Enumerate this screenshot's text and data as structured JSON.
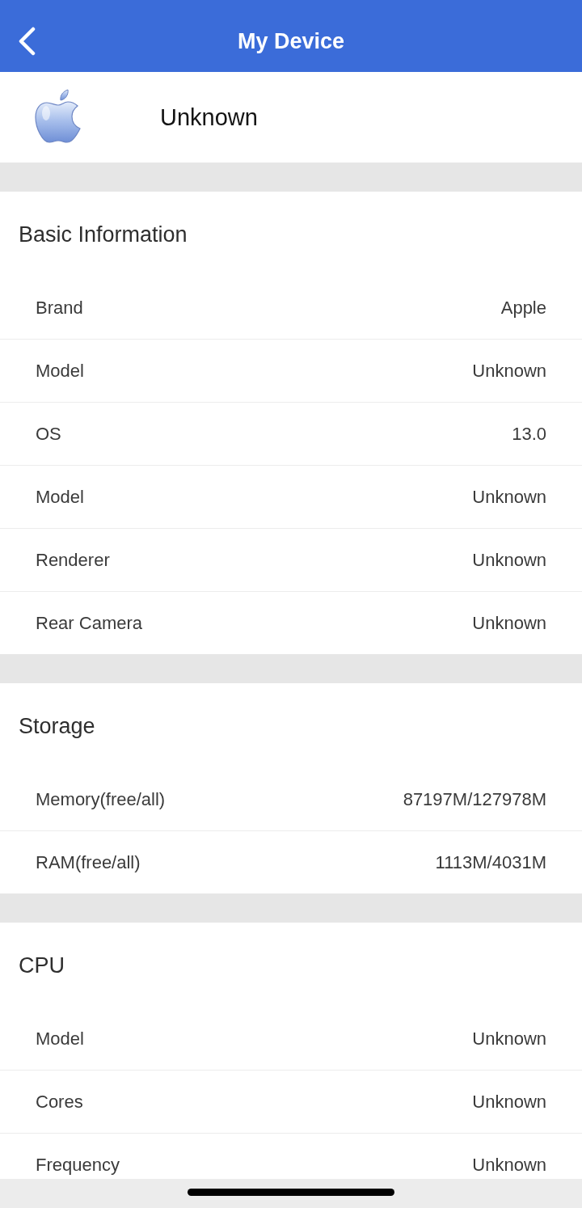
{
  "header": {
    "title": "My Device"
  },
  "device": {
    "name": "Unknown"
  },
  "sections": [
    {
      "title": "Basic Information",
      "rows": [
        {
          "label": "Brand",
          "value": "Apple"
        },
        {
          "label": "Model",
          "value": "Unknown"
        },
        {
          "label": "OS",
          "value": "13.0"
        },
        {
          "label": "Model",
          "value": "Unknown"
        },
        {
          "label": "Renderer",
          "value": "Unknown"
        },
        {
          "label": "Rear Camera",
          "value": "Unknown"
        }
      ]
    },
    {
      "title": "Storage",
      "rows": [
        {
          "label": "Memory(free/all)",
          "value": "87197M/127978M"
        },
        {
          "label": "RAM(free/all)",
          "value": "1113M/4031M"
        }
      ]
    },
    {
      "title": "CPU",
      "rows": [
        {
          "label": "Model",
          "value": "Unknown"
        },
        {
          "label": "Cores",
          "value": "Unknown"
        },
        {
          "label": "Frequency",
          "value": "Unknown"
        }
      ]
    }
  ]
}
